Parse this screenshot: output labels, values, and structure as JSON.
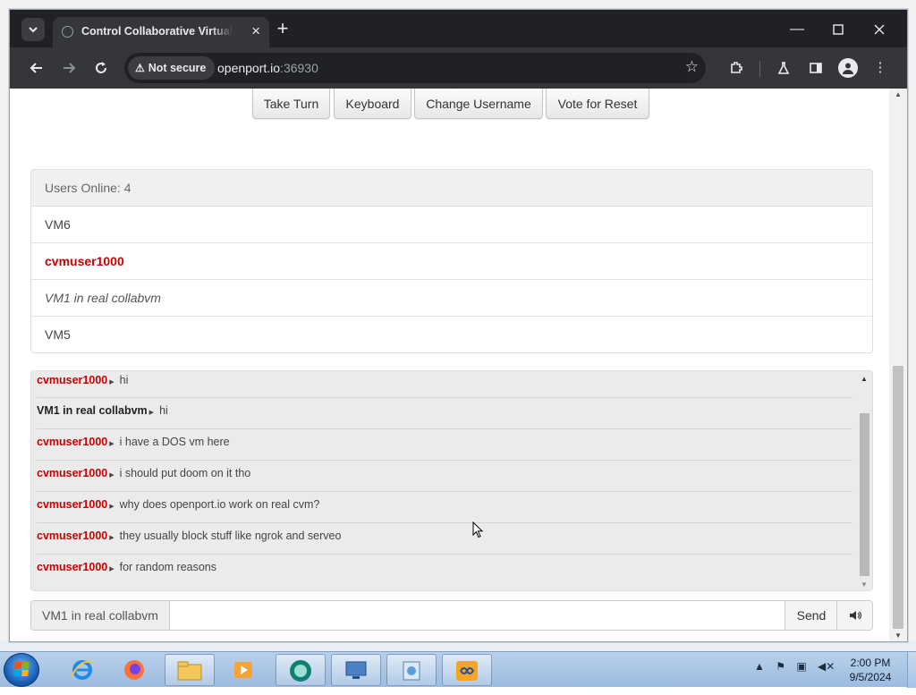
{
  "browser": {
    "tab_title": "Control Collaborative Virtual Machine",
    "security_label": "Not secure",
    "url_host": "openport.io",
    "url_port": ":36930"
  },
  "vm_controls": {
    "buttons": [
      "Take Turn",
      "Keyboard",
      "Change Username",
      "Vote for Reset"
    ]
  },
  "users": {
    "header": "Users Online: 4",
    "list": [
      {
        "name": "VM6",
        "style": "normal"
      },
      {
        "name": "cvmuser1000",
        "style": "highlight"
      },
      {
        "name": "VM1 in real collabvm",
        "style": "italic"
      },
      {
        "name": "VM5",
        "style": "normal"
      }
    ]
  },
  "chat": {
    "messages": [
      {
        "user": "cvmuser1000",
        "text": "hi",
        "user_color": "red"
      },
      {
        "user": "VM1 in real collabvm",
        "text": "hi",
        "user_color": "black"
      },
      {
        "user": "cvmuser1000",
        "text": "i have a DOS vm here",
        "user_color": "red"
      },
      {
        "user": "cvmuser1000",
        "text": "i should put doom on it tho",
        "user_color": "red"
      },
      {
        "user": "cvmuser1000",
        "text": "why does openport.io work on real cvm?",
        "user_color": "red"
      },
      {
        "user": "cvmuser1000",
        "text": "they usually block stuff like ngrok and serveo",
        "user_color": "red"
      },
      {
        "user": "cvmuser1000",
        "text": "for random reasons",
        "user_color": "red"
      }
    ],
    "username_label": "VM1 in real collabvm",
    "input_value": "",
    "send_label": "Send"
  },
  "taskbar": {
    "time": "2:00 PM",
    "date": "9/5/2024",
    "apps": [
      "internet-explorer",
      "firefox",
      "file-explorer",
      "media-player",
      "vm-client",
      "remote-desktop",
      "control-panel",
      "vm-app"
    ]
  },
  "colors": {
    "accent_red": "#cc0000",
    "chrome_dark": "#202124",
    "chrome_toolbar": "#35363a"
  }
}
